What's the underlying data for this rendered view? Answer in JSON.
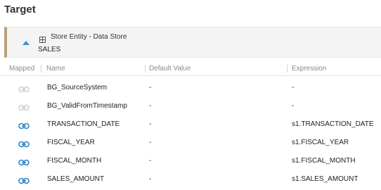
{
  "header": {
    "title": "Target"
  },
  "entity": {
    "type_label": "Store Entity - Data Store",
    "name": "SALES",
    "accent_color": "#b9a27c"
  },
  "table": {
    "columns": [
      "Mapped",
      "Name",
      "Default Value",
      "Expression"
    ],
    "rows": [
      {
        "mapped": false,
        "name": "BG_SourceSystem",
        "default_value": "-",
        "expression": "-"
      },
      {
        "mapped": false,
        "name": "BG_ValidFromTimestamp",
        "default_value": "-",
        "expression": "-"
      },
      {
        "mapped": true,
        "name": "TRANSACTION_DATE",
        "default_value": "-",
        "expression": "s1.TRANSACTION_DATE"
      },
      {
        "mapped": true,
        "name": "FISCAL_YEAR",
        "default_value": "-",
        "expression": "s1.FISCAL_YEAR"
      },
      {
        "mapped": true,
        "name": "FISCAL_MONTH",
        "default_value": "-",
        "expression": "s1.FISCAL_MONTH"
      },
      {
        "mapped": true,
        "name": "SALES_AMOUNT",
        "default_value": "-",
        "expression": "s1.SALES_AMOUNT"
      }
    ]
  },
  "icons": {
    "collapse": "chevron-up-icon",
    "entity": "table-icon",
    "mapped": "link-icon",
    "unmapped": "link-icon"
  },
  "colors": {
    "mapped_link": "#2a86c8",
    "unmapped_link": "#d0d0d0",
    "collapse_arrow": "#3a93d6"
  }
}
